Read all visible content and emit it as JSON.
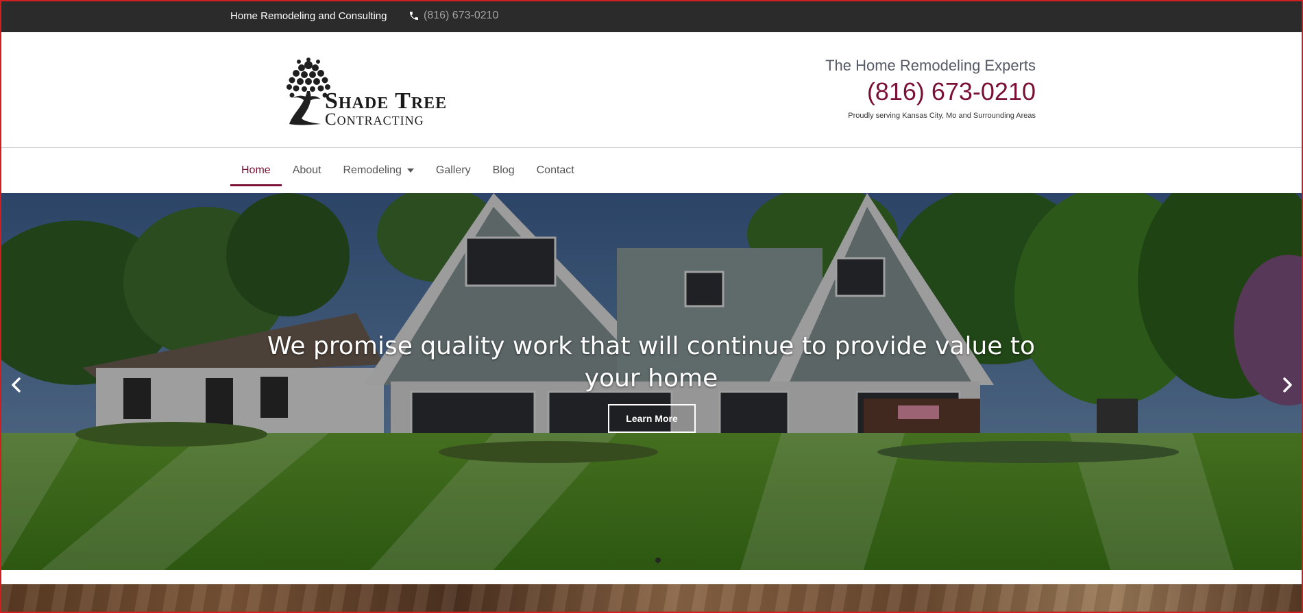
{
  "topbar": {
    "tagline": "Home Remodeling and Consulting",
    "phone": "(816) 673-0210"
  },
  "header": {
    "logo": {
      "line1": "Shade Tree",
      "line2": "Contracting"
    },
    "experts": "The Home Remodeling Experts",
    "phone": "(816) 673-0210",
    "serving": "Proudly serving Kansas City, Mo and Surrounding Areas",
    "accent_color": "#7a1035"
  },
  "nav": {
    "items": [
      {
        "label": "Home",
        "active": true
      },
      {
        "label": "About"
      },
      {
        "label": "Remodeling",
        "has_dropdown": true
      },
      {
        "label": "Gallery"
      },
      {
        "label": "Blog"
      },
      {
        "label": "Contact"
      }
    ]
  },
  "hero": {
    "headline": "We promise quality work that will continue to provide value to your home",
    "cta_label": "Learn More",
    "slide_count": 2,
    "active_slide": 1
  },
  "icons": {
    "phone": "phone-icon",
    "prev": "chevron-left-icon",
    "next": "chevron-right-icon",
    "dropdown": "caret-down-icon"
  }
}
